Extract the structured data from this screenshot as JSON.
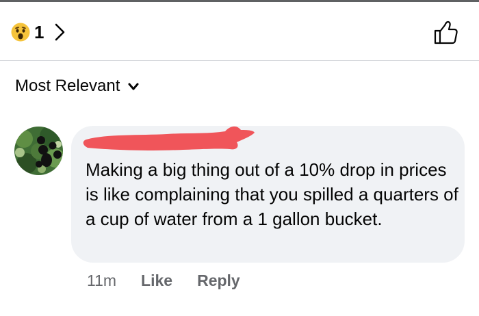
{
  "reactions": {
    "emoji": "wow-emoji",
    "count": "1"
  },
  "sort": {
    "label": "Most Relevant"
  },
  "comment": {
    "author_redacted": true,
    "text": "Making a big thing out of a 10% drop in prices is like complaining that you spilled a quarters of a cup of water from a 1 gallon bucket.",
    "timestamp": "11m",
    "like_label": "Like",
    "reply_label": "Reply"
  },
  "colors": {
    "bubble": "#f0f2f5",
    "secondary_text": "#65676b",
    "redaction": "#f0555a",
    "wow_emoji": "#f5c33b"
  }
}
